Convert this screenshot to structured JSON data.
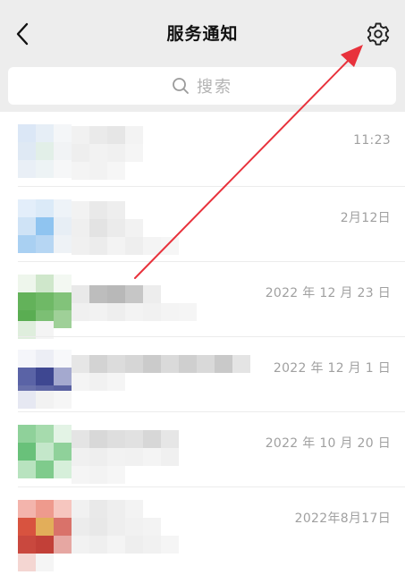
{
  "header": {
    "title": "服务通知",
    "back_icon": "chevron-left-icon",
    "settings_icon": "gear-icon"
  },
  "search": {
    "placeholder": "搜索",
    "icon": "search-icon"
  },
  "notifications": [
    {
      "time": "11:23"
    },
    {
      "time": "2月12日"
    },
    {
      "time": "2022 年 12 月 23 日"
    },
    {
      "time": "2022 年 12 月 1 日"
    },
    {
      "time": "2022 年 10 月 20 日"
    },
    {
      "time": "2022年8月17日"
    }
  ],
  "annotation": {
    "arrow_color": "#e8323c"
  }
}
